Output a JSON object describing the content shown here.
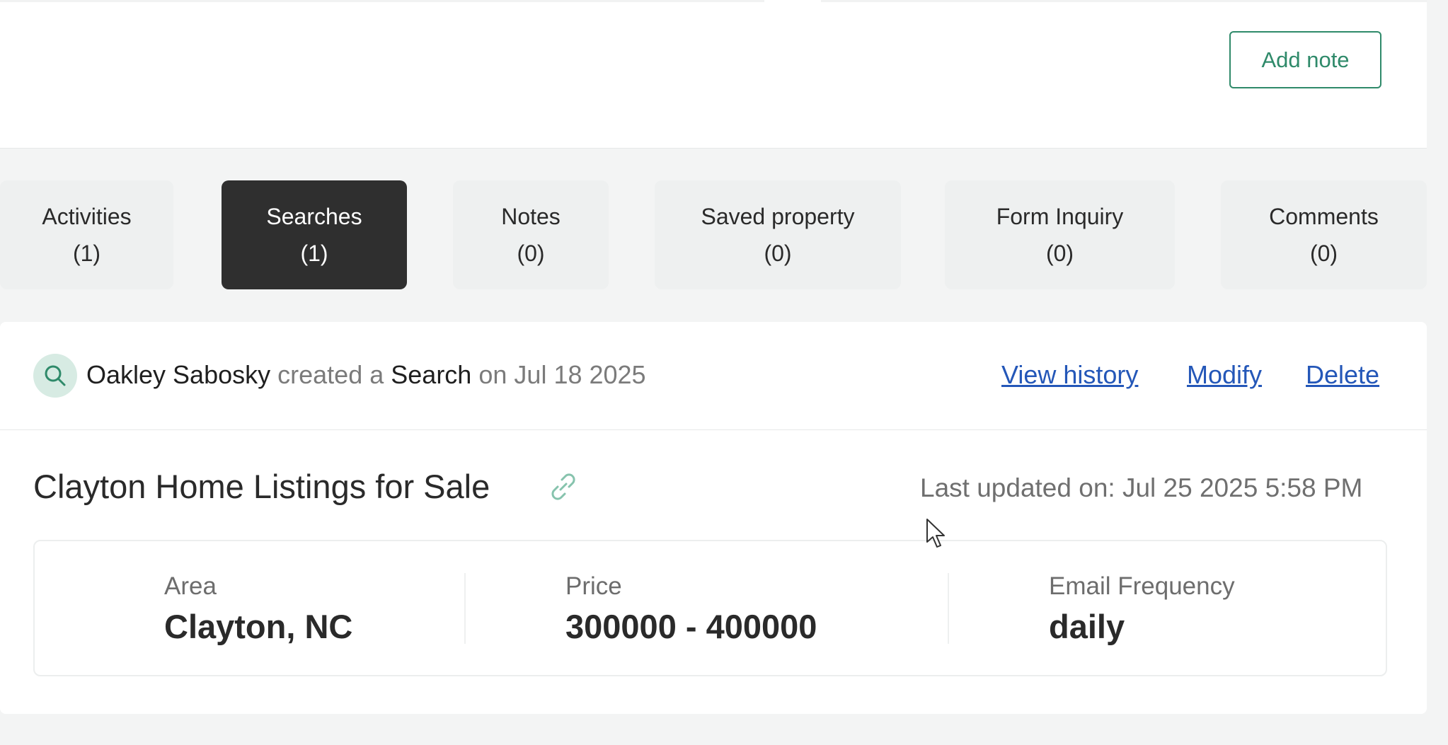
{
  "top_card": {
    "add_note_label": "Add note"
  },
  "tabs": [
    {
      "label": "Activities",
      "count": "(1)",
      "active": false
    },
    {
      "label": "Searches",
      "count": "(1)",
      "active": true
    },
    {
      "label": "Notes",
      "count": "(0)",
      "active": false
    },
    {
      "label": "Saved property",
      "count": "(0)",
      "active": false
    },
    {
      "label": "Form Inquiry",
      "count": "(0)",
      "active": false
    },
    {
      "label": "Comments",
      "count": "(0)",
      "active": false
    }
  ],
  "search_entry": {
    "icon": "search-icon",
    "user_name": "Oakley Sabosky",
    "verb": "created a",
    "object": "Search",
    "date_prefix": "on",
    "date": "Jul 18 2025",
    "actions": {
      "view_history": "View history",
      "modify": "Modify",
      "delete": "Delete"
    },
    "title": "Clayton Home Listings for Sale",
    "link_icon": "link-icon",
    "last_updated_label": "Last updated on:",
    "last_updated_value": "Jul 25 2025 5:58 PM",
    "details": {
      "area_label": "Area",
      "area_value": "Clayton, NC",
      "price_label": "Price",
      "price_value": "300000 - 400000",
      "frequency_label": "Email Frequency",
      "frequency_value": "daily"
    }
  },
  "colors": {
    "accent_green": "#2f8a6a",
    "link_blue": "#2457b8",
    "active_tab_bg": "#2f2f2f",
    "page_bg": "#f3f4f4"
  }
}
